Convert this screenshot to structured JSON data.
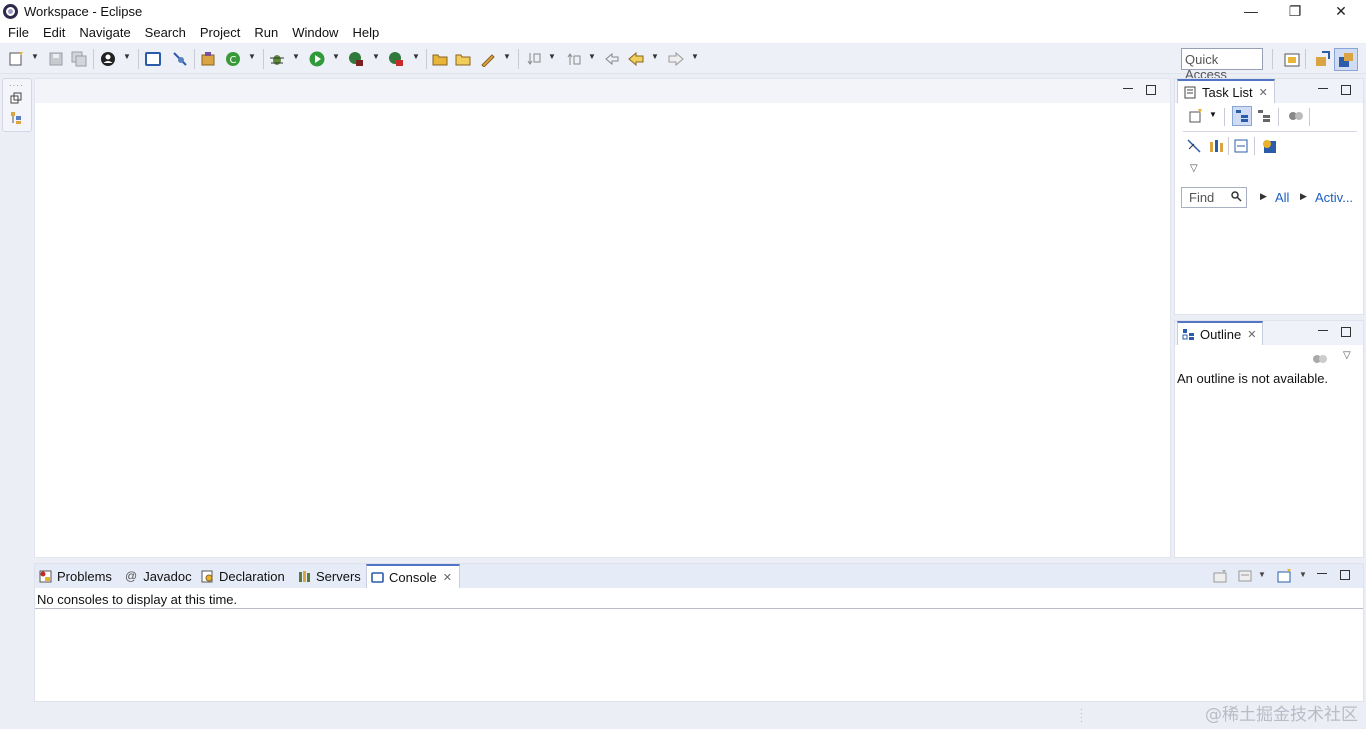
{
  "window": {
    "title": "Workspace - Eclipse",
    "minimize": "—",
    "restore": "❐",
    "close": "✕"
  },
  "menu": [
    "File",
    "Edit",
    "Navigate",
    "Search",
    "Project",
    "Run",
    "Window",
    "Help"
  ],
  "toolbar": {
    "quick_access": "Quick Access"
  },
  "task_list": {
    "tab_label": "Task List",
    "find_placeholder": "Find",
    "all_label": "All",
    "activate_label": "Activ..."
  },
  "outline": {
    "tab_label": "Outline",
    "message": "An outline is not available."
  },
  "bottom": {
    "tabs": [
      {
        "label": "Problems"
      },
      {
        "label": "Javadoc"
      },
      {
        "label": "Declaration"
      },
      {
        "label": "Servers"
      },
      {
        "label": "Console"
      }
    ],
    "active_tab": "Console",
    "console_message": "No consoles to display at this time."
  },
  "watermark": "@稀土掘金技术社区",
  "colors": {
    "accent": "#4f75c4",
    "link": "#1b5fbd",
    "chrome": "#eceef6"
  }
}
